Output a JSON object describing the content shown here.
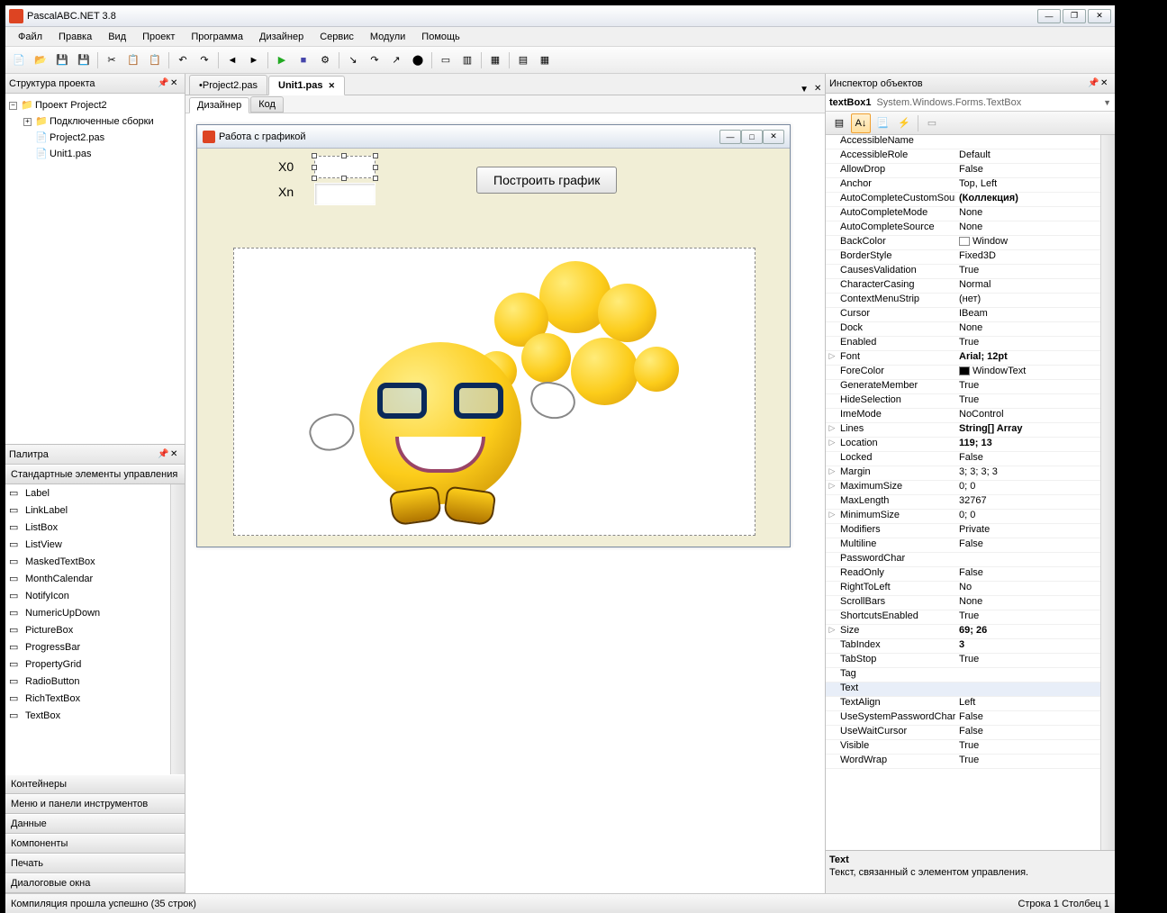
{
  "app_title": "PascalABC.NET 3.8",
  "menu": [
    "Файл",
    "Правка",
    "Вид",
    "Проект",
    "Программа",
    "Дизайнер",
    "Сервис",
    "Модули",
    "Помощь"
  ],
  "structure": {
    "title": "Структура проекта",
    "root": "Проект Project2",
    "folder": "Подключенные сборки",
    "files": [
      "Project2.pas",
      "Unit1.pas"
    ]
  },
  "palette": {
    "title": "Палитра",
    "group": "Стандартные элементы управления",
    "items": [
      "Label",
      "LinkLabel",
      "ListBox",
      "ListView",
      "MaskedTextBox",
      "MonthCalendar",
      "NotifyIcon",
      "NumericUpDown",
      "PictureBox",
      "ProgressBar",
      "PropertyGrid",
      "RadioButton",
      "RichTextBox",
      "TextBox"
    ],
    "groups": [
      "Контейнеры",
      "Меню и панели инструментов",
      "Данные",
      "Компоненты",
      "Печать",
      "Диалоговые окна"
    ]
  },
  "tabs": [
    "•Project2.pas",
    "Unit1.pas"
  ],
  "active_tab": 1,
  "subtabs": [
    "Дизайнер",
    "Код"
  ],
  "form": {
    "title": "Работа с графикой",
    "label_x0": "X0",
    "label_xn": "Xn",
    "button": "Построить график"
  },
  "inspector": {
    "title": "Инспектор объектов",
    "obj_name": "textBox1",
    "obj_type": "System.Windows.Forms.TextBox",
    "desc_title": "Text",
    "desc_text": "Текст, связанный с элементом управления."
  },
  "props": [
    {
      "e": "",
      "n": "AccessibleName",
      "v": ""
    },
    {
      "e": "",
      "n": "AccessibleRole",
      "v": "Default"
    },
    {
      "e": "",
      "n": "AllowDrop",
      "v": "False"
    },
    {
      "e": "",
      "n": "Anchor",
      "v": "Top, Left"
    },
    {
      "e": "",
      "n": "AutoCompleteCustomSour",
      "v": "(Коллекция)",
      "b": 1
    },
    {
      "e": "",
      "n": "AutoCompleteMode",
      "v": "None"
    },
    {
      "e": "",
      "n": "AutoCompleteSource",
      "v": "None"
    },
    {
      "e": "",
      "n": "BackColor",
      "v": "Window",
      "sw": "#fff"
    },
    {
      "e": "",
      "n": "BorderStyle",
      "v": "Fixed3D"
    },
    {
      "e": "",
      "n": "CausesValidation",
      "v": "True"
    },
    {
      "e": "",
      "n": "CharacterCasing",
      "v": "Normal"
    },
    {
      "e": "",
      "n": "ContextMenuStrip",
      "v": "(нет)"
    },
    {
      "e": "",
      "n": "Cursor",
      "v": "IBeam"
    },
    {
      "e": "",
      "n": "Dock",
      "v": "None"
    },
    {
      "e": "",
      "n": "Enabled",
      "v": "True"
    },
    {
      "e": "▷",
      "n": "Font",
      "v": "Arial; 12pt",
      "b": 1
    },
    {
      "e": "",
      "n": "ForeColor",
      "v": "WindowText",
      "sw": "#000"
    },
    {
      "e": "",
      "n": "GenerateMember",
      "v": "True"
    },
    {
      "e": "",
      "n": "HideSelection",
      "v": "True"
    },
    {
      "e": "",
      "n": "ImeMode",
      "v": "NoControl"
    },
    {
      "e": "▷",
      "n": "Lines",
      "v": "String[] Array",
      "b": 1
    },
    {
      "e": "▷",
      "n": "Location",
      "v": "119; 13",
      "b": 1
    },
    {
      "e": "",
      "n": "Locked",
      "v": "False"
    },
    {
      "e": "▷",
      "n": "Margin",
      "v": "3; 3; 3; 3"
    },
    {
      "e": "▷",
      "n": "MaximumSize",
      "v": "0; 0"
    },
    {
      "e": "",
      "n": "MaxLength",
      "v": "32767"
    },
    {
      "e": "▷",
      "n": "MinimumSize",
      "v": "0; 0"
    },
    {
      "e": "",
      "n": "Modifiers",
      "v": "Private"
    },
    {
      "e": "",
      "n": "Multiline",
      "v": "False"
    },
    {
      "e": "",
      "n": "PasswordChar",
      "v": ""
    },
    {
      "e": "",
      "n": "ReadOnly",
      "v": "False"
    },
    {
      "e": "",
      "n": "RightToLeft",
      "v": "No"
    },
    {
      "e": "",
      "n": "ScrollBars",
      "v": "None"
    },
    {
      "e": "",
      "n": "ShortcutsEnabled",
      "v": "True"
    },
    {
      "e": "▷",
      "n": "Size",
      "v": "69; 26",
      "b": 1
    },
    {
      "e": "",
      "n": "TabIndex",
      "v": "3",
      "b": 1
    },
    {
      "e": "",
      "n": "TabStop",
      "v": "True"
    },
    {
      "e": "",
      "n": "Tag",
      "v": ""
    },
    {
      "e": "",
      "n": "Text",
      "v": "",
      "sel": 1
    },
    {
      "e": "",
      "n": "TextAlign",
      "v": "Left"
    },
    {
      "e": "",
      "n": "UseSystemPasswordChar",
      "v": "False"
    },
    {
      "e": "",
      "n": "UseWaitCursor",
      "v": "False"
    },
    {
      "e": "",
      "n": "Visible",
      "v": "True"
    },
    {
      "e": "",
      "n": "WordWrap",
      "v": "True"
    }
  ],
  "status": {
    "left": "Компиляция прошла успешно (35 строк)",
    "right": "Строка 1  Столбец 1"
  }
}
